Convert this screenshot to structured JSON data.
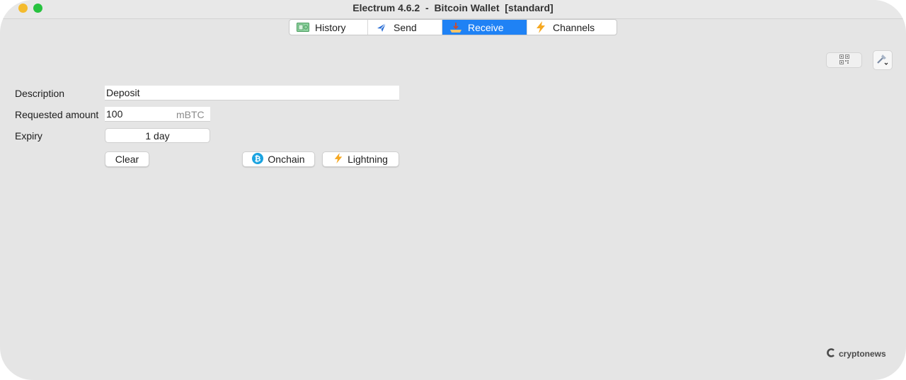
{
  "window": {
    "title": "Electrum 4.6.2  -  Bitcoin Wallet  [standard]"
  },
  "tabs": [
    {
      "label": "History",
      "icon": "history-icon",
      "active": false
    },
    {
      "label": "Send",
      "icon": "send-icon",
      "active": false
    },
    {
      "label": "Receive",
      "icon": "receive-icon",
      "active": true
    },
    {
      "label": "Channels",
      "icon": "lightning-icon",
      "active": false
    }
  ],
  "toolbar": {
    "qr_button_icon": "qr-code-icon",
    "tools_button_icon": "tools-icon"
  },
  "form": {
    "description_label": "Description",
    "description_value": "Deposit",
    "amount_label": "Requested amount",
    "amount_value": "100",
    "amount_unit": "mBTC",
    "expiry_label": "Expiry",
    "expiry_value": "1 day"
  },
  "buttons": {
    "clear": "Clear",
    "onchain": "Onchain",
    "lightning": "Lightning"
  },
  "watermark": {
    "text": "cryptonews"
  },
  "colors": {
    "accent": "#1f82f5",
    "bitcoin_badge": "#1aa3e0",
    "lightning": "#f6a821"
  }
}
